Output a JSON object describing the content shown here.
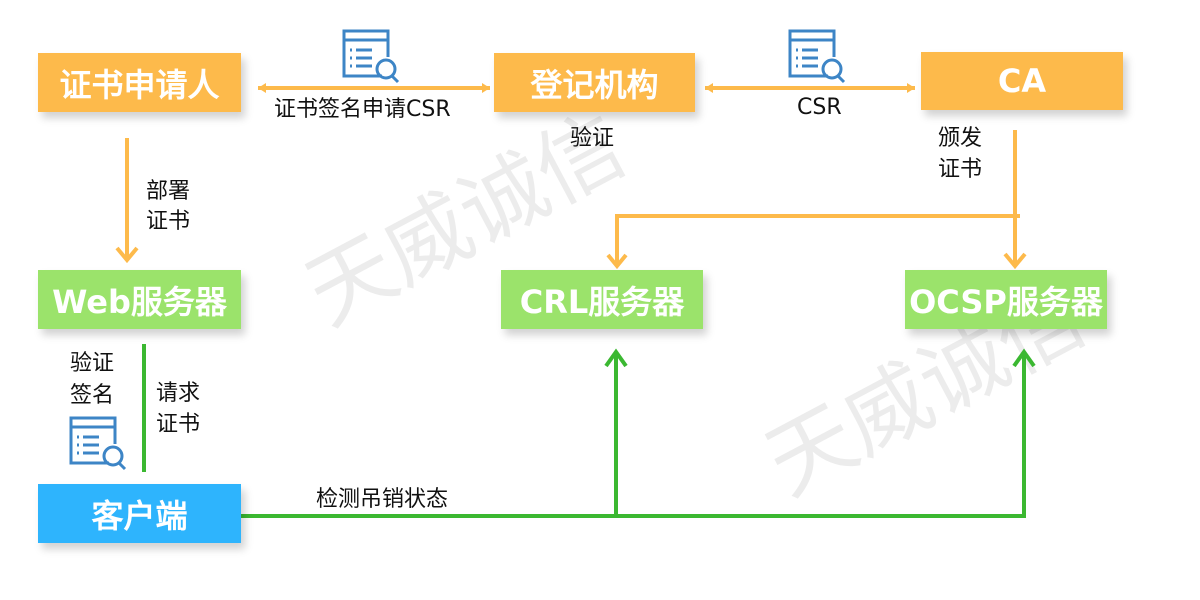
{
  "watermark": "天威诚信",
  "colors": {
    "orange": "#FDBA4B",
    "green": "#9BE36B",
    "blue": "#2EB4FD",
    "orange_arrow": "#FDBA4B",
    "green_arrow": "#3BB831",
    "icon": "#3D85C6"
  },
  "nodes": {
    "applicant": "证书申请人",
    "ra": "登记机构",
    "ca": "CA",
    "web": "Web服务器",
    "crl": "CRL服务器",
    "ocsp": "OCSP服务器",
    "client": "客户端"
  },
  "labels": {
    "csr_request": "证书签名申请CSR",
    "csr": "CSR",
    "verify": "验证",
    "issue_1": "颁发",
    "issue_2": "证书",
    "deploy_1": "部署",
    "deploy_2": "证书",
    "verify_sig_1": "验证",
    "verify_sig_2": "签名",
    "request_cert_1": "请求",
    "request_cert_2": "证书",
    "check_revocation": "检测吊销状态"
  },
  "icons": [
    "document-search-icon",
    "document-search-icon",
    "document-search-icon"
  ]
}
